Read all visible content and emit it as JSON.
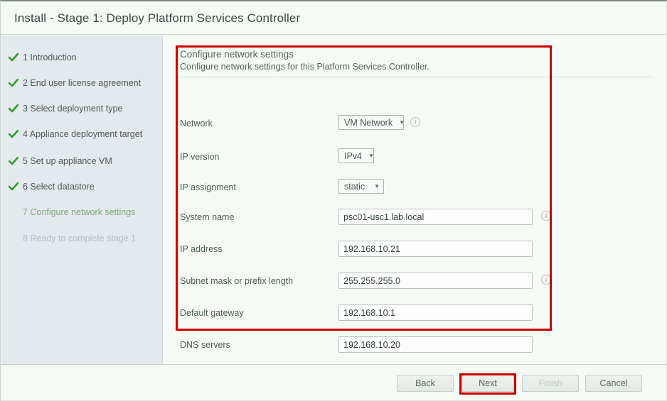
{
  "window": {
    "title": "Install - Stage 1: Deploy Platform Services Controller"
  },
  "sidebar": {
    "steps": [
      {
        "number": "1",
        "label": "1 Introduction",
        "state": "done"
      },
      {
        "number": "2",
        "label": "2 End user license agreement",
        "state": "done"
      },
      {
        "number": "3",
        "label": "3 Select deployment type",
        "state": "done"
      },
      {
        "number": "4",
        "label": "4 Appliance deployment target",
        "state": "done"
      },
      {
        "number": "5",
        "label": "5 Set up appliance VM",
        "state": "done"
      },
      {
        "number": "6",
        "label": "6 Select datastore",
        "state": "done"
      },
      {
        "number": "7",
        "label": "7 Configure network settings",
        "state": "current"
      },
      {
        "number": "8",
        "label": "8 Ready to complete stage 1",
        "state": "pending"
      }
    ]
  },
  "panel": {
    "heading": "Configure network settings",
    "subheading": "Configure network settings for this Platform Services Controller.",
    "fields": {
      "network": {
        "label": "Network",
        "value": "VM Network",
        "has_info": true
      },
      "ip_version": {
        "label": "IP version",
        "value": "IPv4",
        "has_info": false
      },
      "ip_assignment": {
        "label": "IP assignment",
        "value": "static",
        "has_info": false
      },
      "system_name": {
        "label": "System name",
        "value": "psc01-usc1.lab.local",
        "has_info": true
      },
      "ip_address": {
        "label": "IP address",
        "value": "192.168.10.21",
        "has_info": false
      },
      "subnet_mask": {
        "label": "Subnet mask or prefix length",
        "value": "255.255.255.0",
        "has_info": true
      },
      "default_gateway": {
        "label": "Default gateway",
        "value": "192.168.10.1",
        "has_info": false
      },
      "dns_servers": {
        "label": "DNS servers",
        "value": "192.168.10.20",
        "has_info": false
      }
    },
    "info_glyph": "i"
  },
  "footer": {
    "back": "Back",
    "next": "Next",
    "finish": "Finish",
    "cancel": "Cancel"
  },
  "colors": {
    "highlight": "#cc0000",
    "checkmark": "#2b9e2b",
    "sidebar_bg": "#e4e9ed",
    "content_bg": "#f5faf5",
    "current_step": "#7aa87a",
    "pending_step": "#b3bdc0"
  }
}
